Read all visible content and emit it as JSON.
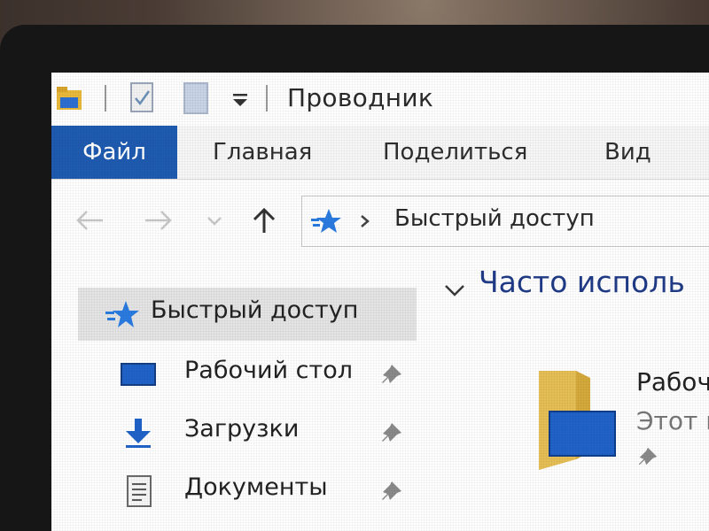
{
  "window": {
    "title": "Проводник",
    "quick_access_toolbar": [
      "folder-icon",
      "properties-icon",
      "new-folder-icon",
      "customize-dropdown-icon"
    ]
  },
  "ribbon": {
    "tabs": [
      {
        "label": "Файл",
        "active": true
      },
      {
        "label": "Главная"
      },
      {
        "label": "Поделиться"
      },
      {
        "label": "Вид"
      }
    ],
    "file_tab_color": "#1e5bb0"
  },
  "address_bar": {
    "icon": "quick-access-star-icon",
    "path": "Быстрый доступ"
  },
  "navigation_pane": {
    "items": [
      {
        "label": "Быстрый доступ",
        "icon": "star-icon",
        "selected": true
      },
      {
        "label": "Рабочий стол",
        "icon": "desktop-icon",
        "pinned": true
      },
      {
        "label": "Загрузки",
        "icon": "download-icon",
        "pinned": true
      },
      {
        "label": "Документы",
        "icon": "document-icon",
        "pinned": true
      }
    ]
  },
  "content": {
    "group_title": "Часто исполь",
    "tiles": [
      {
        "name": "Рабоч",
        "subtitle": "Этот к",
        "icon": "desktop-folder-icon",
        "pinned": true
      }
    ]
  },
  "colors": {
    "accent": "#1e5bb0",
    "group_title": "#1f3a86",
    "star": "#2a7be0"
  }
}
